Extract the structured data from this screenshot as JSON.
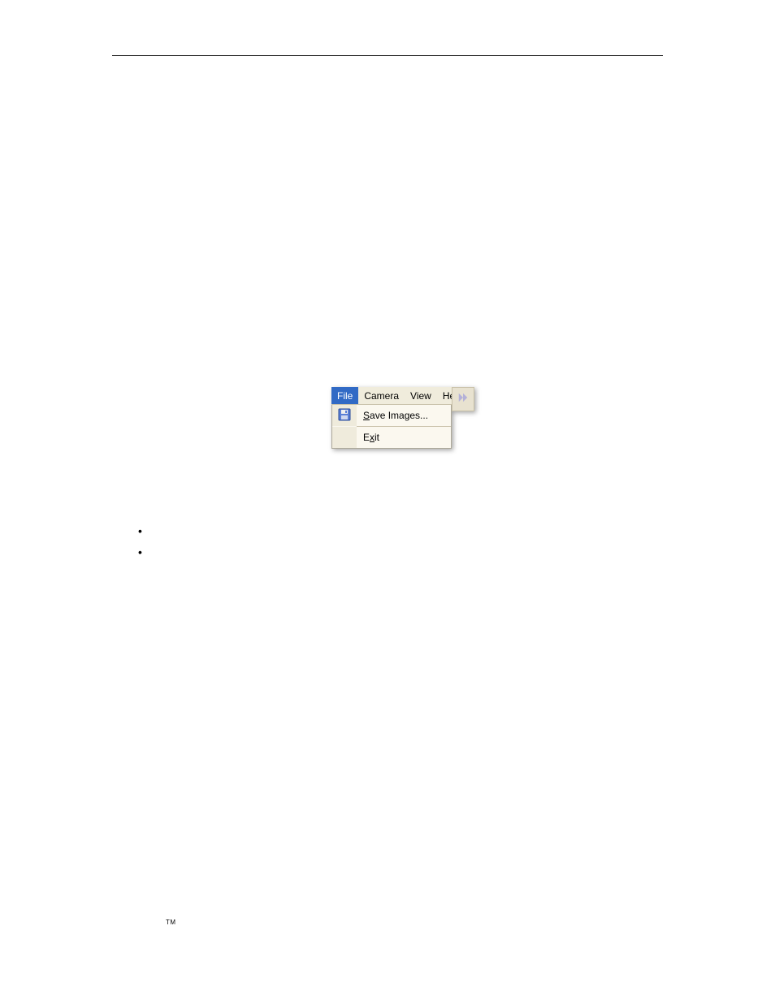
{
  "menubar": {
    "file": "File",
    "camera": "Camera",
    "view": "View",
    "help": "Help"
  },
  "file_menu": {
    "save": {
      "underline": "S",
      "rest": "ave Images..."
    },
    "exit": {
      "pre": "E",
      "underline": "x",
      "rest": "it"
    }
  },
  "bullets": [
    "•",
    "•"
  ],
  "footer": {
    "tm": "TM"
  }
}
